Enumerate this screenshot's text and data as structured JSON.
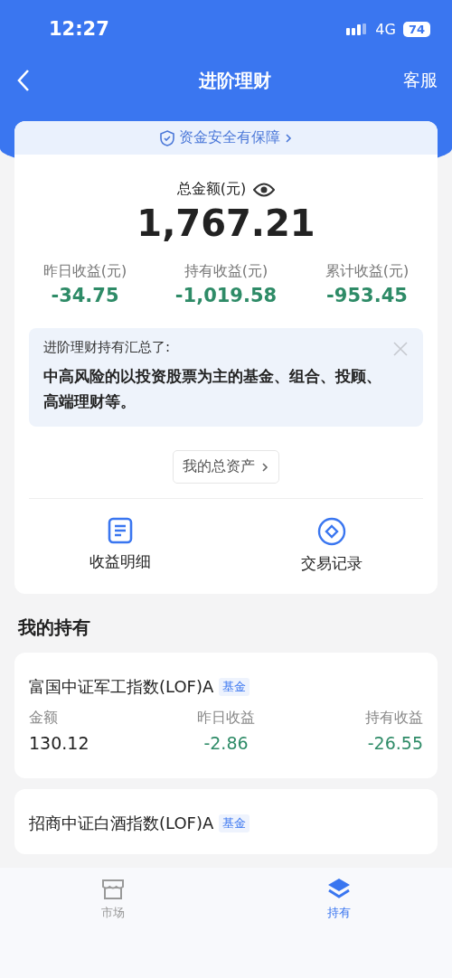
{
  "status_bar": {
    "time": "12:27",
    "network": "4G",
    "battery": "74"
  },
  "header": {
    "title": "进阶理财",
    "action": "客服"
  },
  "summary": {
    "banner": "资金安全有保障",
    "total_label": "总金额(元)",
    "total": "1,767.21",
    "stats": [
      {
        "label": "昨日收益(元)",
        "value": "-34.75"
      },
      {
        "label": "持有收益(元)",
        "value": "-1,019.58"
      },
      {
        "label": "累计收益(元)",
        "value": "-953.45"
      }
    ],
    "notice": {
      "title": "进阶理财持有汇总了:",
      "body": "中高风险的以投资股票为主的基金、组合、投顾、高端理财等。"
    },
    "assets_button": "我的总资产",
    "actions": [
      {
        "label": "收益明细",
        "kind": "document"
      },
      {
        "label": "交易记录",
        "kind": "diamond"
      }
    ]
  },
  "holdings": {
    "title": "我的持有",
    "items": [
      {
        "name": "富国中证军工指数(LOF)A",
        "tag": "基金",
        "columns": [
          {
            "label": "金额",
            "value": "130.12",
            "kind": "plain"
          },
          {
            "label": "昨日收益",
            "value": "-2.86",
            "kind": "change"
          },
          {
            "label": "持有收益",
            "value": "-26.55",
            "kind": "change"
          }
        ]
      },
      {
        "name": "招商中证白酒指数(LOF)A",
        "tag": "基金"
      }
    ]
  },
  "tab_bar": [
    {
      "label": "市场",
      "kind": "market",
      "selected": false
    },
    {
      "label": "持有",
      "kind": "layers",
      "selected": true
    }
  ]
}
